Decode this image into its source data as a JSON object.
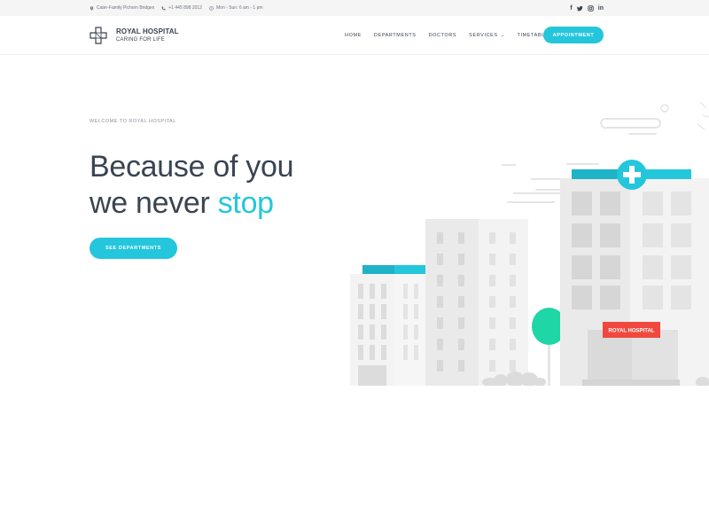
{
  "topbar": {
    "address": "Cater-Family Pichorn Bridges",
    "phone": "+1 445 898 2012",
    "hours": "Mon - Sun: 6 am - 1 pm",
    "social": [
      "facebook-icon",
      "twitter-icon",
      "instagram-icon",
      "linkedin-icon"
    ]
  },
  "header": {
    "logo_name": "ROYAL HOSPITAL",
    "logo_tagline": "CARING FOR LIFE",
    "nav": {
      "home": "HOME",
      "departments": "DEPARTMENTS",
      "doctors": "DOCTORS",
      "services": "SERVICES",
      "timetable": "TIMETABLE"
    },
    "appointment_label": "APPOINTMENT"
  },
  "hero": {
    "tagline": "WELCOME TO ROYAL HOSPITAL",
    "title_line1": "Because of you",
    "title_line2_start": "we never ",
    "title_line2_accent": "stop",
    "button_label": "SEE DEPARTMENTS"
  },
  "illustration": {
    "sign_label": "ROYAL HOSPITAL"
  },
  "colors": {
    "accent": "#24c6dc",
    "text": "#3a4451",
    "tree": "#1fd6a6",
    "sign": "#f0483e",
    "building_light": "#f3f3f3",
    "building_dark": "#e6e6e6",
    "window": "#dcdcdc"
  }
}
